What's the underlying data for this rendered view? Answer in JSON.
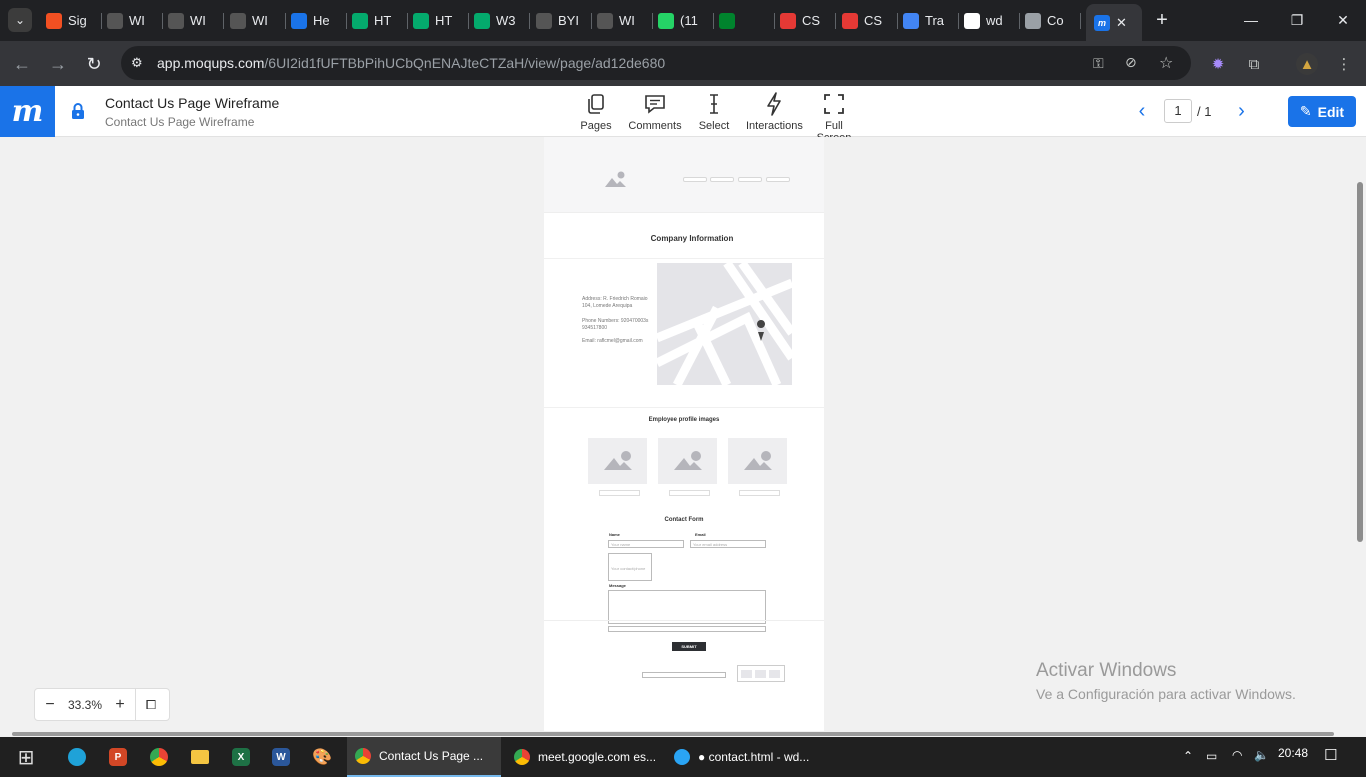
{
  "browser": {
    "tabs": [
      {
        "label": "Sig",
        "icon": "microsoft-icon",
        "color": "#f25022"
      },
      {
        "label": "WI",
        "icon": "byu-icon",
        "color": "#555555"
      },
      {
        "label": "WI",
        "icon": "byu-icon",
        "color": "#555555"
      },
      {
        "label": "WI",
        "icon": "byu-icon",
        "color": "#555555"
      },
      {
        "label": "He",
        "icon": "pluralsight-icon",
        "color": "#1a73e8"
      },
      {
        "label": "HT",
        "icon": "w3schools-icon",
        "color": "#04aa6d"
      },
      {
        "label": "HT",
        "icon": "w3schools-icon",
        "color": "#04aa6d"
      },
      {
        "label": "W3",
        "icon": "w3schools-icon",
        "color": "#04aa6d"
      },
      {
        "label": "BYI",
        "icon": "byu-icon",
        "color": "#555555"
      },
      {
        "label": "WI",
        "icon": "byu-icon",
        "color": "#555555"
      },
      {
        "label": "(11",
        "icon": "whatsapp-icon",
        "color": "#25d366"
      },
      {
        "label": "",
        "icon": "meet-icon",
        "color": "#00832d"
      },
      {
        "label": "CS",
        "icon": "asterisk-icon",
        "color": "#e53935"
      },
      {
        "label": "CS",
        "icon": "asterisk-icon",
        "color": "#e53935"
      },
      {
        "label": "Tra",
        "icon": "translate-icon",
        "color": "#4285f4"
      },
      {
        "label": "wd",
        "icon": "github-icon",
        "color": "#ffffff"
      },
      {
        "label": "Co",
        "icon": "globe-icon",
        "color": "#9aa0a6"
      }
    ],
    "active_tab_icon": "moqups-icon",
    "url_host": "app.moqups.com",
    "url_path": "/6UI2id1fUFTBbPihUCbQnENAJteCTZaH/view/page/ad12de680"
  },
  "header": {
    "title": "Contact Us Page Wireframe",
    "subtitle": "Contact Us Page Wireframe",
    "tools": [
      {
        "label": "Pages",
        "icon": "pages-icon"
      },
      {
        "label": "Comments",
        "icon": "comments-icon"
      },
      {
        "label": "Select",
        "icon": "text-cursor-icon"
      },
      {
        "label": "Interactions",
        "icon": "lightning-icon"
      },
      {
        "label": "Full Screen",
        "icon": "fullscreen-icon"
      }
    ],
    "page_current": "1",
    "page_total": "/ 1",
    "edit_label": "Edit"
  },
  "wireframe": {
    "company_heading": "Company Information",
    "address": "Address: R. Friedrich Romaio 104, Lomede Arequipa",
    "phone": "Phone Numbers: 920470003s 934517800",
    "email": "Email: raflcmel@gmail.com",
    "employees_heading": "Employee profile images",
    "form_heading": "Contact Form",
    "name_label": "Name",
    "name_placeholder": "Your name",
    "email_label": "Email",
    "email_placeholder": "Your email address",
    "extra_placeholder": "Your contact/phone",
    "message_label": "Message",
    "submit_label": "SUBMIT"
  },
  "zoom": {
    "value": "33.3%",
    "minus": "−",
    "plus": "+"
  },
  "watermark": {
    "line1": "Activar Windows",
    "line2": "Ve a Configuración para activar Windows."
  },
  "taskbar": {
    "windows": [
      {
        "label": "Contact Us Page ...",
        "icon": "chrome-icon"
      },
      {
        "label": "meet.google.com es...",
        "icon": "chrome-icon"
      },
      {
        "label": "● contact.html - wd...",
        "icon": "vscode-icon"
      }
    ],
    "time": "20:48"
  }
}
